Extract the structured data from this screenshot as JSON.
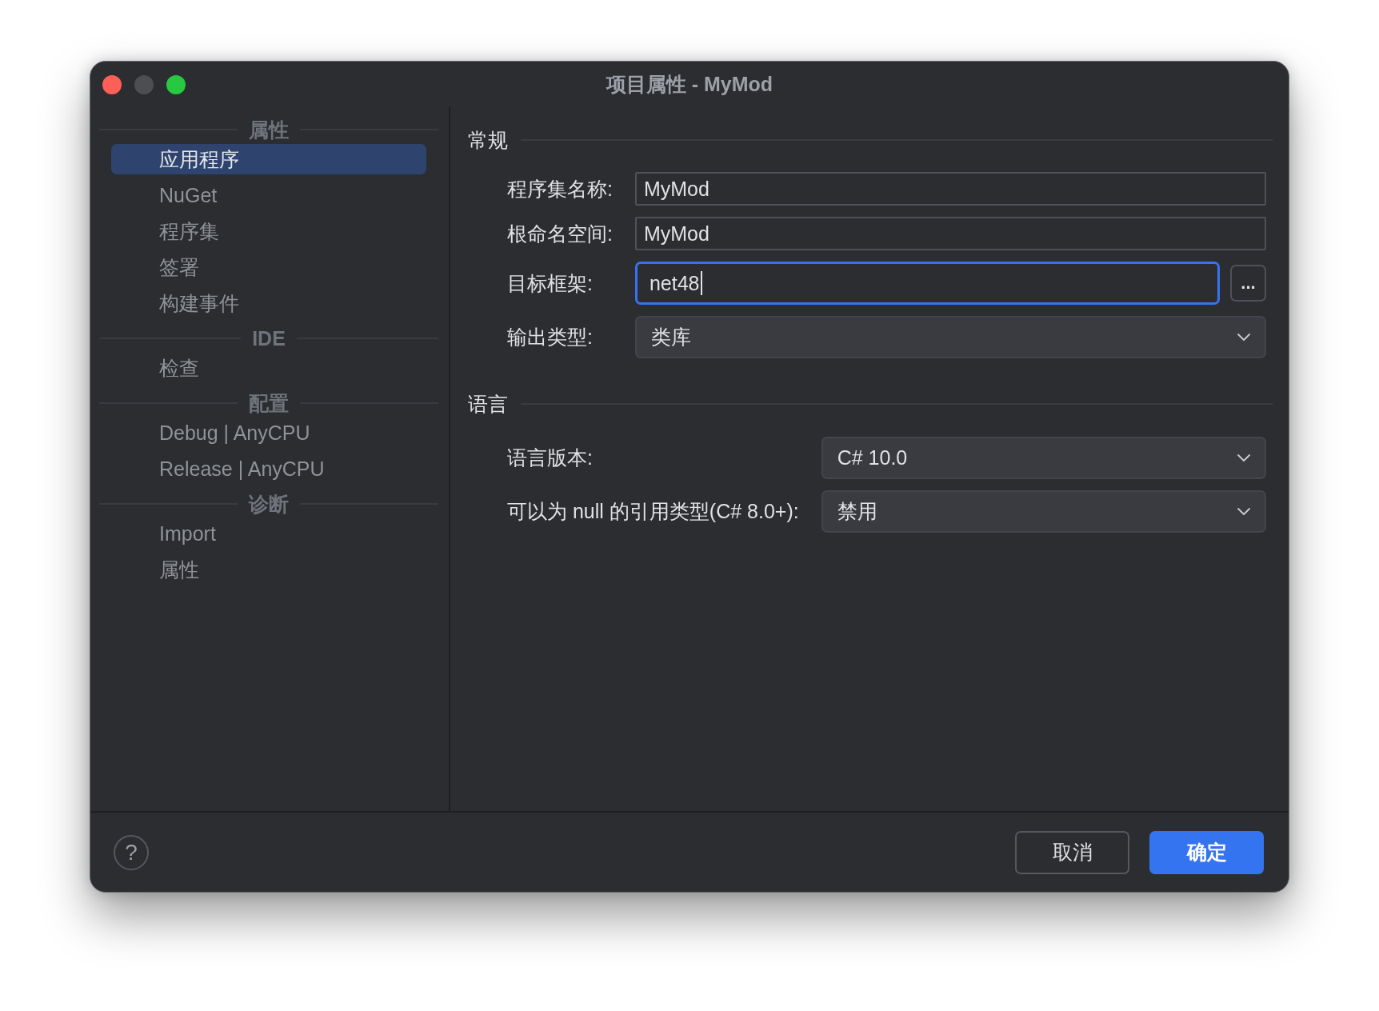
{
  "window": {
    "title": "项目属性 - MyMod",
    "controls": [
      {
        "kind": "close",
        "disabled": false
      },
      {
        "kind": "minimize",
        "disabled": true
      },
      {
        "kind": "zoom",
        "disabled": false
      }
    ]
  },
  "sidebar": {
    "sections": [
      {
        "header": "属性",
        "items": [
          {
            "label": "应用程序",
            "selected": true
          },
          {
            "label": "NuGet",
            "selected": false
          },
          {
            "label": "程序集",
            "selected": false
          },
          {
            "label": "签署",
            "selected": false
          },
          {
            "label": "构建事件",
            "selected": false
          }
        ]
      },
      {
        "header": "IDE",
        "items": [
          {
            "label": "检查",
            "selected": false
          }
        ]
      },
      {
        "header": "配置",
        "items": [
          {
            "label": "Debug | AnyCPU",
            "selected": false
          },
          {
            "label": "Release | AnyCPU",
            "selected": false
          }
        ]
      },
      {
        "header": "诊断",
        "items": [
          {
            "label": "Import",
            "selected": false
          },
          {
            "label": "属性",
            "selected": false
          }
        ]
      }
    ]
  },
  "main": {
    "groups": [
      {
        "title": "常规",
        "fields": [
          {
            "kind": "text",
            "label": "程序集名称:",
            "value": "MyMod",
            "focused": false
          },
          {
            "kind": "text",
            "label": "根命名空间:",
            "value": "MyMod",
            "focused": false
          },
          {
            "kind": "text",
            "label": "目标框架:",
            "value": "net48",
            "focused": true,
            "browse_button": "..."
          },
          {
            "kind": "select",
            "label": "输出类型:",
            "value": "类库",
            "focused": false
          }
        ]
      },
      {
        "title": "语言",
        "fields": [
          {
            "kind": "select",
            "label": "语言版本:",
            "value": "C# 10.0",
            "focused": false
          },
          {
            "kind": "select",
            "label": "可以为 null 的引用类型(C# 8.0+):",
            "value": "禁用",
            "focused": false
          }
        ]
      }
    ]
  },
  "footer": {
    "help_button": "?",
    "buttons": [
      {
        "label": "取消",
        "kind": "secondary"
      },
      {
        "label": "确定",
        "kind": "primary"
      }
    ]
  }
}
